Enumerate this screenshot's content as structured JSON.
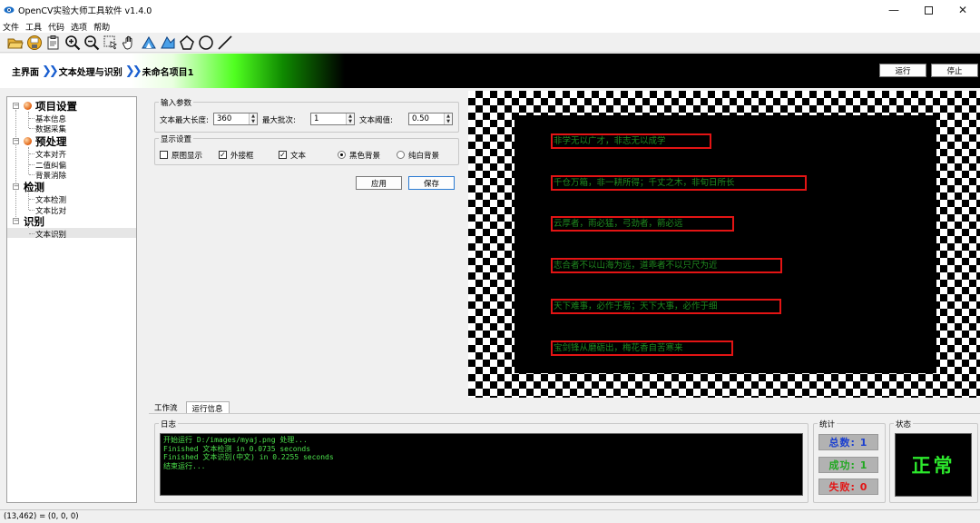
{
  "window": {
    "title": "OpenCV实验大师工具软件 v1.4.0",
    "controls": [
      "minimize",
      "maximize",
      "close"
    ]
  },
  "menu": [
    "文件",
    "工具",
    "代码",
    "选项",
    "帮助"
  ],
  "toolbar": {
    "icons": [
      "open-folder-icon",
      "save-icon",
      "clipboard-icon",
      "zoom-in-icon",
      "zoom-out-icon",
      "select-icon",
      "hand-icon",
      "roi-icon",
      "polyline-icon",
      "polygon-icon",
      "circle-icon",
      "line-icon"
    ]
  },
  "breadcrumb": {
    "items": [
      "主界面",
      "文本处理与识别",
      "未命名项目1"
    ],
    "separator": "❯❯"
  },
  "actions": {
    "run": "运行",
    "stop": "停止"
  },
  "tree": {
    "categories": [
      {
        "label": "项目设置",
        "children": [
          "基本信息",
          "数据采集"
        ]
      },
      {
        "label": "预处理",
        "children": [
          "文本对齐",
          "二值纠偏",
          "背景消除"
        ]
      },
      {
        "label": "检测",
        "children": [
          "文本检测",
          "文本比对"
        ]
      },
      {
        "label": "识别",
        "children": [
          "文本识别"
        ]
      }
    ],
    "selected": "文本识别"
  },
  "params": {
    "group_label": "输入参数",
    "max_length_label": "文本最大长度:",
    "max_length_value": "360",
    "max_batch_label": "最大批次:",
    "max_batch_value": "1",
    "threshold_label": "文本阈值:",
    "threshold_value": "0.50"
  },
  "display": {
    "group_label": "显示设置",
    "options": [
      {
        "label": "原图显示",
        "checked": false
      },
      {
        "label": "外接框",
        "checked": true
      },
      {
        "label": "文本",
        "checked": true
      }
    ],
    "background": {
      "black": "黑色背景",
      "white": "纯白背景",
      "selected": "黑色背景"
    }
  },
  "buttons": {
    "apply": "应用",
    "save": "保存"
  },
  "image": {
    "lines": [
      "非学无以广才，非志无以成学",
      "千仓万箱，非一耕所得；千丈之木，非旬日所长",
      "云厚者，雨必猛，弓劲者，箭必远",
      "志合者不以山海为远，道乖者不以只尺为近",
      "天下难事，必作于易；天下大事，必作于细",
      "宝剑锋从磨砺出，梅花香自苦寒来"
    ],
    "text_color": "#1f8a1f",
    "box_color": "#e31414"
  },
  "tabs": {
    "items": [
      "工作流",
      "运行信息"
    ],
    "active": "运行信息"
  },
  "log": {
    "label": "日志",
    "lines": [
      "开始运行 D:/images/myaj.png 处理...",
      "Finished 文本检测 in 0.0735 seconds",
      "Finished 文本识别(中文) in 0.2255 seconds",
      "结束运行..."
    ],
    "color": "#4ce24c"
  },
  "stats": {
    "label": "统计",
    "total": "总数: 1",
    "success": "成功: 1",
    "fail": "失败: 0",
    "colors": {
      "total": "#1a3fd0",
      "success": "#1fa81f",
      "fail": "#e31414"
    }
  },
  "status": {
    "label": "状态",
    "text": "正常",
    "color": "#2ce82c"
  },
  "statusbar": {
    "text": "(13,462) = (0, 0, 0)"
  }
}
